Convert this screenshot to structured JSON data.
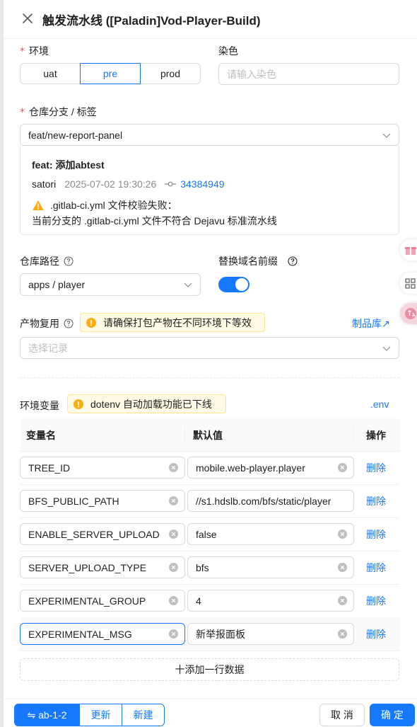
{
  "header": {
    "title": "触发流水线 ([Paladin]Vod-Player-Build)"
  },
  "env": {
    "label": "环境",
    "required_mark": "*",
    "options": [
      "uat",
      "pre",
      "prod"
    ],
    "selected": "pre"
  },
  "dye": {
    "label": "染色",
    "placeholder": "请输入染色"
  },
  "branch": {
    "label": "仓库分支 / 标签",
    "required_mark": "*",
    "value": "feat/new-report-panel",
    "commit": {
      "title": "feat: 添加abtest",
      "author": "satori",
      "date": "2025-07-02 19:30:26",
      "hash": "34384949",
      "warn_line1": ".gitlab-ci.yml 文件校验失败：",
      "warn_line2": "当前分支的 .gitlab-ci.yml 文件不符合 Dejavu 标准流水线"
    }
  },
  "repo_path": {
    "label": "仓库路径",
    "value": "apps / player"
  },
  "domain_prefix": {
    "label": "替换域名前缀",
    "enabled": true
  },
  "artifact": {
    "label": "产物复用",
    "alert": "请确保打包产物在不同环境下等效",
    "link": "制品库↗",
    "placeholder": "选择记录"
  },
  "envvars": {
    "label": "环境变量",
    "alert": "dotenv 自动加载功能已下线",
    "link": ".env",
    "columns": {
      "name": "变量名",
      "value": "默认值",
      "action": "操作"
    },
    "rows": [
      {
        "name": "TREE_ID",
        "value": "mobile.web-player.player",
        "action": "删除"
      },
      {
        "name": "BFS_PUBLIC_PATH",
        "value": "//s1.hdslb.com/bfs/static/player",
        "action": "删除"
      },
      {
        "name": "ENABLE_SERVER_UPLOAD",
        "value": "false",
        "action": "删除"
      },
      {
        "name": "SERVER_UPLOAD_TYPE",
        "value": "bfs",
        "action": "删除"
      },
      {
        "name": "EXPERIMENTAL_GROUP",
        "value": "4",
        "action": "删除"
      },
      {
        "name": "EXPERIMENTAL_MSG",
        "value": "新举报面板",
        "action": "删除"
      }
    ],
    "add_label": "十添加一行数据"
  },
  "footer": {
    "branch_btn": "⇋ ab-1-2",
    "update_btn": "更新",
    "new_btn": "新建",
    "cancel_btn": "取 消",
    "confirm_btn": "确 定"
  },
  "colors": {
    "primary": "#1677ff",
    "required": "#ff4d4f",
    "warning": "#faad14"
  }
}
